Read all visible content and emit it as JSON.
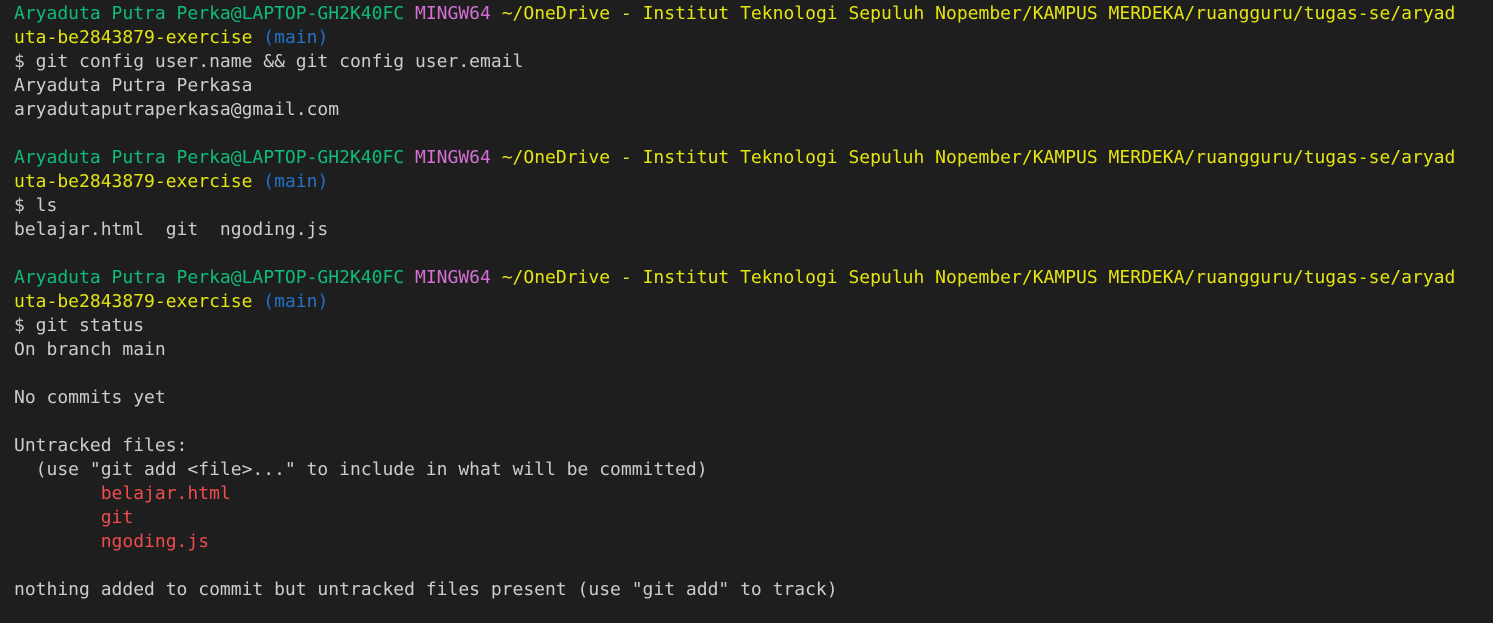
{
  "colors": {
    "background": "#1e1e1e",
    "foreground": "#cccccc",
    "user_host": "#0dbc79",
    "system": "#d670d6",
    "path": "#e5e510",
    "branch": "#2472c8",
    "untracked": "#f14c4c"
  },
  "prompt": {
    "user_host": "Aryaduta Putra Perka@LAPTOP-GH2K40FC",
    "system": "MINGW64",
    "path_part1": "~/OneDrive - Institut Teknologi Sepuluh Nopember/KAMPUS MERDEKA/ruangguru/tugas-se/aryad",
    "path_part2": "uta-be2843879-exercise",
    "branch": "(main)"
  },
  "blocks": [
    {
      "command": "$ git config user.name && git config user.email",
      "output": [
        "Aryaduta Putra Perkasa",
        "aryadutaputraperkasa@gmail.com"
      ]
    },
    {
      "command": "$ ls",
      "output": [
        "belajar.html  git  ngoding.js"
      ]
    },
    {
      "command": "$ git status",
      "status": {
        "branch_line": "On branch main",
        "commits_line": "No commits yet",
        "untracked_header": "Untracked files:",
        "hint": "  (use \"git add <file>...\" to include in what will be committed)",
        "files": [
          "belajar.html",
          "git",
          "ngoding.js"
        ],
        "footer": "nothing added to commit but untracked files present (use \"git add\" to track)"
      }
    }
  ]
}
